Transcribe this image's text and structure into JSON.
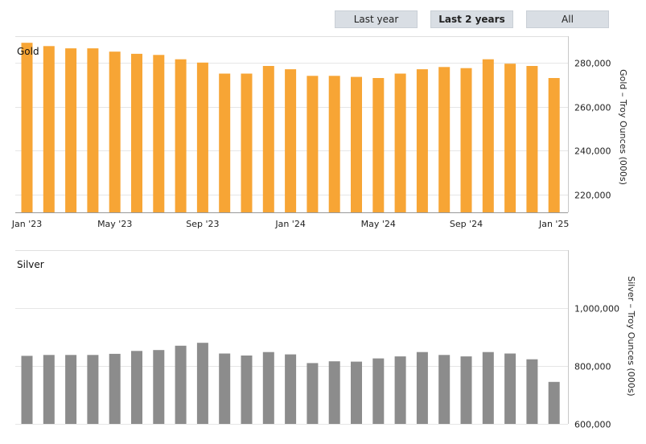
{
  "range_buttons": [
    {
      "label": "Last year",
      "active": false
    },
    {
      "label": "Last 2 years",
      "active": true
    },
    {
      "label": "All",
      "active": false
    }
  ],
  "chart_data": [
    {
      "type": "bar",
      "title": "Gold",
      "ylabel": "Gold – Troy Ounces (000s)",
      "color": "#f7a535",
      "ylim": [
        212000,
        292000
      ],
      "y_ticks": [
        {
          "value": 220000,
          "label": "220,000"
        },
        {
          "value": 240000,
          "label": "240,000"
        },
        {
          "value": 260000,
          "label": "260,000"
        },
        {
          "value": 280000,
          "label": "280,000"
        }
      ],
      "x_tick_labels": [
        {
          "index": 0,
          "label": "Jan '23"
        },
        {
          "index": 4,
          "label": "May '23"
        },
        {
          "index": 8,
          "label": "Sep '23"
        },
        {
          "index": 12,
          "label": "Jan '24"
        },
        {
          "index": 16,
          "label": "May '24"
        },
        {
          "index": 20,
          "label": "Sep '24"
        },
        {
          "index": 24,
          "label": "Jan '25"
        }
      ],
      "categories": [
        "2023-01",
        "2023-02",
        "2023-03",
        "2023-04",
        "2023-05",
        "2023-06",
        "2023-07",
        "2023-08",
        "2023-09",
        "2023-10",
        "2023-11",
        "2023-12",
        "2024-01",
        "2024-02",
        "2024-03",
        "2024-04",
        "2024-05",
        "2024-06",
        "2024-07",
        "2024-08",
        "2024-09",
        "2024-10",
        "2024-11",
        "2024-12",
        "2025-01"
      ],
      "values": [
        289000,
        287500,
        286500,
        286500,
        285000,
        284000,
        283500,
        281500,
        280000,
        275000,
        275000,
        278500,
        277000,
        274000,
        274000,
        273500,
        273000,
        275000,
        277000,
        278000,
        277500,
        281500,
        279500,
        278500,
        273000
      ],
      "grid": true
    },
    {
      "type": "bar",
      "title": "Silver",
      "ylabel": "Silver – Troy Ounces (000s)",
      "color": "#8c8c8c",
      "ylim": [
        600000,
        1200000
      ],
      "y_ticks": [
        {
          "value": 600000,
          "label": "600,000"
        },
        {
          "value": 800000,
          "label": "800,000"
        },
        {
          "value": 1000000,
          "label": "1,000,000"
        }
      ],
      "categories": [
        "2023-01",
        "2023-02",
        "2023-03",
        "2023-04",
        "2023-05",
        "2023-06",
        "2023-07",
        "2023-08",
        "2023-09",
        "2023-10",
        "2023-11",
        "2023-12",
        "2024-01",
        "2024-02",
        "2024-03",
        "2024-04",
        "2024-05",
        "2024-06",
        "2024-07",
        "2024-08",
        "2024-09",
        "2024-10",
        "2024-11",
        "2024-12",
        "2025-01"
      ],
      "values": [
        835000,
        838000,
        838000,
        838000,
        842000,
        852000,
        855000,
        870000,
        880000,
        843000,
        836000,
        848000,
        840000,
        810000,
        816000,
        815000,
        826000,
        833000,
        848000,
        838000,
        833000,
        848000,
        843000,
        823000,
        745000
      ],
      "grid": true
    }
  ]
}
